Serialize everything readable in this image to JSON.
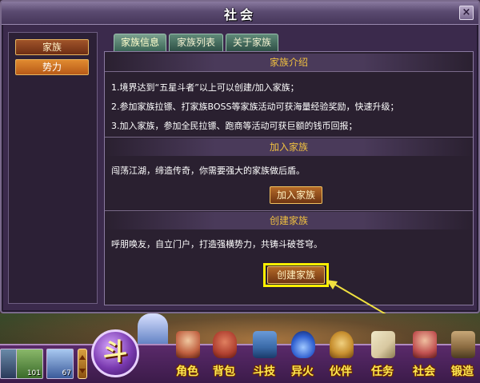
{
  "dialog": {
    "title": "社会",
    "close_label": "×"
  },
  "leftnav": {
    "items": [
      {
        "label": "家族"
      },
      {
        "label": "势力"
      }
    ]
  },
  "tabs": [
    {
      "label": "家族信息",
      "active": true
    },
    {
      "label": "家族列表",
      "active": false
    },
    {
      "label": "关于家族",
      "active": false
    }
  ],
  "intro": {
    "heading": "家族介绍",
    "lines": [
      "1.境界达到“五星斗者”以上可以创建/加入家族；",
      "2.参加家族拉镖、打家族BOSS等家族活动可获海量经验奖励，快速升级；",
      "3.加入家族，参加全民拉镖、跑商等活动可获巨额的钱币回报；"
    ]
  },
  "join": {
    "heading": "加入家族",
    "text": "闯荡江湖，缔造传奇，你需要强大的家族做后盾。",
    "button": "加入家族"
  },
  "create": {
    "heading": "创建家族",
    "text": "呼朋唤友，自立门户，打造强横势力，共铸斗破苍穹。",
    "button": "创建家族"
  },
  "hud": {
    "pets": [
      {
        "icon": "pet-portrait-icon",
        "count": ""
      },
      {
        "icon": "pet-portrait-icon",
        "count": "101"
      },
      {
        "icon": "pet-portrait-icon",
        "count": "67"
      }
    ],
    "main_button": "斗",
    "menu": [
      {
        "label": "角色",
        "icon": "character-icon",
        "color": "#c06040"
      },
      {
        "label": "背包",
        "icon": "bag-icon",
        "color": "#b04030"
      },
      {
        "label": "斗技",
        "icon": "skill-book-icon",
        "color": "#3a6aa8"
      },
      {
        "label": "异火",
        "icon": "fire-icon",
        "color": "#3060d0"
      },
      {
        "label": "伙伴",
        "icon": "bell-icon",
        "color": "#c89030"
      },
      {
        "label": "任务",
        "icon": "scroll-icon",
        "color": "#d8c8a0"
      },
      {
        "label": "社会",
        "icon": "society-icon",
        "color": "#c05050"
      },
      {
        "label": "锻造",
        "icon": "forge-icon",
        "color": "#8a6a40"
      }
    ]
  },
  "colors": {
    "accent_gold": "#f0c040",
    "highlight": "#fff000"
  }
}
